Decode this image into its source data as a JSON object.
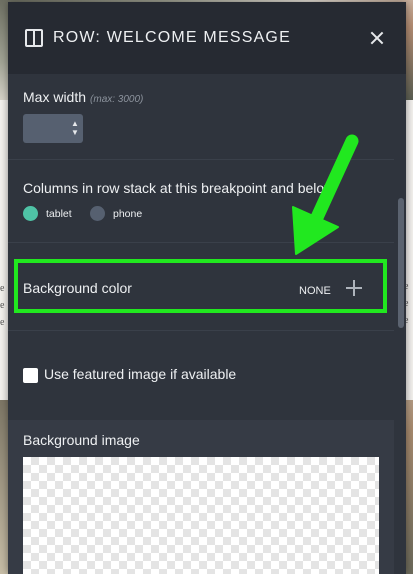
{
  "background": {
    "left_fragments": [
      "e",
      "e",
      "e"
    ],
    "right_fragments": [
      "e",
      "e",
      "e"
    ]
  },
  "panel": {
    "title": "ROW: WELCOME MESSAGE",
    "header_icon": "columns-icon",
    "close_icon": "close-icon"
  },
  "max_width": {
    "label": "Max width",
    "hint": "(max: 3000)",
    "value": ""
  },
  "stack": {
    "label": "Columns in row stack at this breakpoint and below",
    "options": [
      {
        "label": "tablet",
        "selected": true
      },
      {
        "label": "phone",
        "selected": false
      }
    ]
  },
  "background_color": {
    "label": "Background color",
    "value": "NONE",
    "add_icon": "plus-icon",
    "highlight_color": "#21e81f"
  },
  "featured_image": {
    "label": "Use featured image if available",
    "checked": false
  },
  "background_image": {
    "label": "Background image"
  },
  "colors": {
    "panel": "#2f343d",
    "header": "#262a32",
    "accent": "#4fc3a6",
    "annotation": "#21e81f"
  }
}
